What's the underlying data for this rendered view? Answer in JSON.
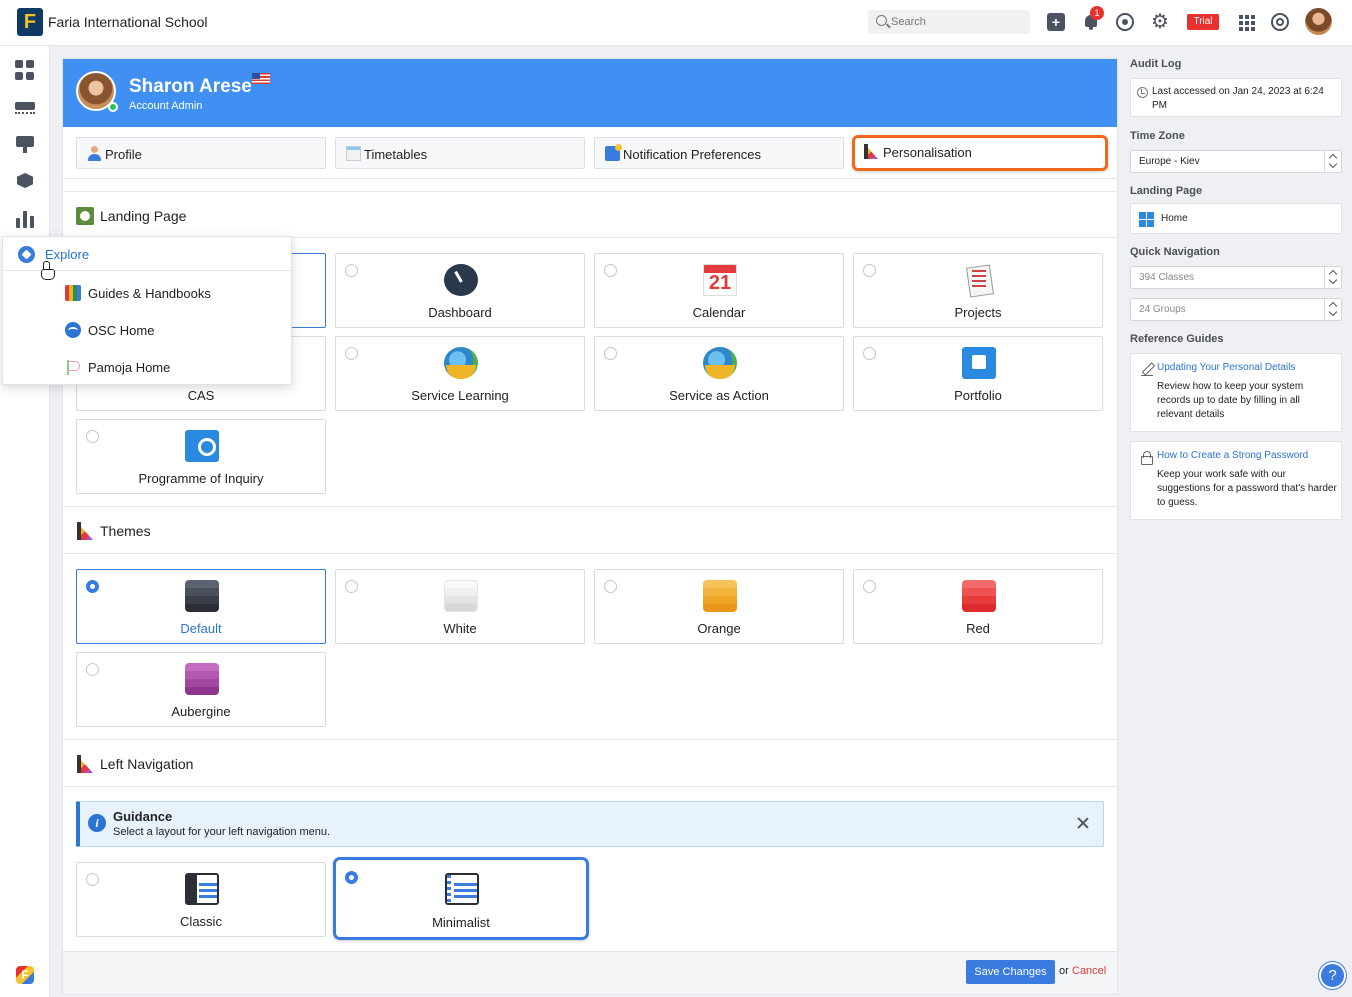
{
  "topbar": {
    "logo_letter": "F",
    "school_name": "Faria International School",
    "search_placeholder": "Search",
    "notification_count": "1",
    "trial_label": "Trial"
  },
  "explore_menu": {
    "title": "Explore",
    "items": [
      {
        "label": "Guides & Handbooks",
        "icon": "books-icon"
      },
      {
        "label": "OSC Home",
        "icon": "osc-icon"
      },
      {
        "label": "Pamoja Home",
        "icon": "pamoja-icon"
      }
    ]
  },
  "profile": {
    "name": "Sharon Arese",
    "role": "Account Admin"
  },
  "tabs": [
    {
      "label": "Profile",
      "icon": "person-icon"
    },
    {
      "label": "Timetables",
      "icon": "timetable-icon"
    },
    {
      "label": "Notification Preferences",
      "icon": "notification-preferences-icon"
    },
    {
      "label": "Personalisation",
      "icon": "personalisation-icon",
      "active": true
    }
  ],
  "landing_page": {
    "title": "Landing Page",
    "options": [
      {
        "label": "Dashboard",
        "icon": "dashboard-gauge-icon"
      },
      {
        "label": "Calendar",
        "icon": "calendar-icon",
        "calendar_day": "21"
      },
      {
        "label": "Projects",
        "icon": "projects-icon"
      },
      {
        "label": "CAS"
      },
      {
        "label": "Service Learning",
        "icon": "globe-hands-icon"
      },
      {
        "label": "Service as Action",
        "icon": "globe-hands-icon"
      },
      {
        "label": "Portfolio",
        "icon": "portfolio-icon"
      },
      {
        "label": "Programme of Inquiry",
        "icon": "inquiry-icon"
      }
    ]
  },
  "themes": {
    "title": "Themes",
    "selected": "Default",
    "options": [
      {
        "label": "Default",
        "color": "#3a3e48"
      },
      {
        "label": "White",
        "color": "#eeeeee"
      },
      {
        "label": "Orange",
        "color": "#f0a82a"
      },
      {
        "label": "Red",
        "color": "#e83c3c"
      },
      {
        "label": "Aubergine",
        "color": "#a2469f"
      }
    ]
  },
  "left_navigation": {
    "title": "Left Navigation",
    "guidance_title": "Guidance",
    "guidance_text": "Select a layout for your left navigation menu.",
    "selected": "Minimalist",
    "options": [
      {
        "label": "Classic"
      },
      {
        "label": "Minimalist"
      }
    ]
  },
  "footer": {
    "save_label": "Save Changes",
    "or_label": "or",
    "cancel_label": "Cancel"
  },
  "right_panel": {
    "audit_log_heading": "Audit Log",
    "audit_log_text": "Last accessed on Jan 24, 2023 at 6:24 PM",
    "time_zone_heading": "Time Zone",
    "time_zone_value": "Europe - Kiev",
    "landing_page_heading": "Landing Page",
    "landing_page_value": "Home",
    "quick_nav_heading": "Quick Navigation",
    "quick_nav_classes": "394 Classes",
    "quick_nav_groups": "24 Groups",
    "reference_guides_heading": "Reference Guides",
    "guides": [
      {
        "title": "Updating Your Personal Details",
        "description": "Review how to keep your system records up to date by filling in all relevant details"
      },
      {
        "title": "How to Create a Strong Password",
        "description": "Keep your work safe with our suggestions for a password that's harder to guess."
      }
    ]
  },
  "help_button_label": "?",
  "colors": {
    "accent": "#3a7be0",
    "header_blue": "#3f90f2",
    "highlight_orange": "#f06a1d",
    "danger_red": "#e23a3a"
  }
}
